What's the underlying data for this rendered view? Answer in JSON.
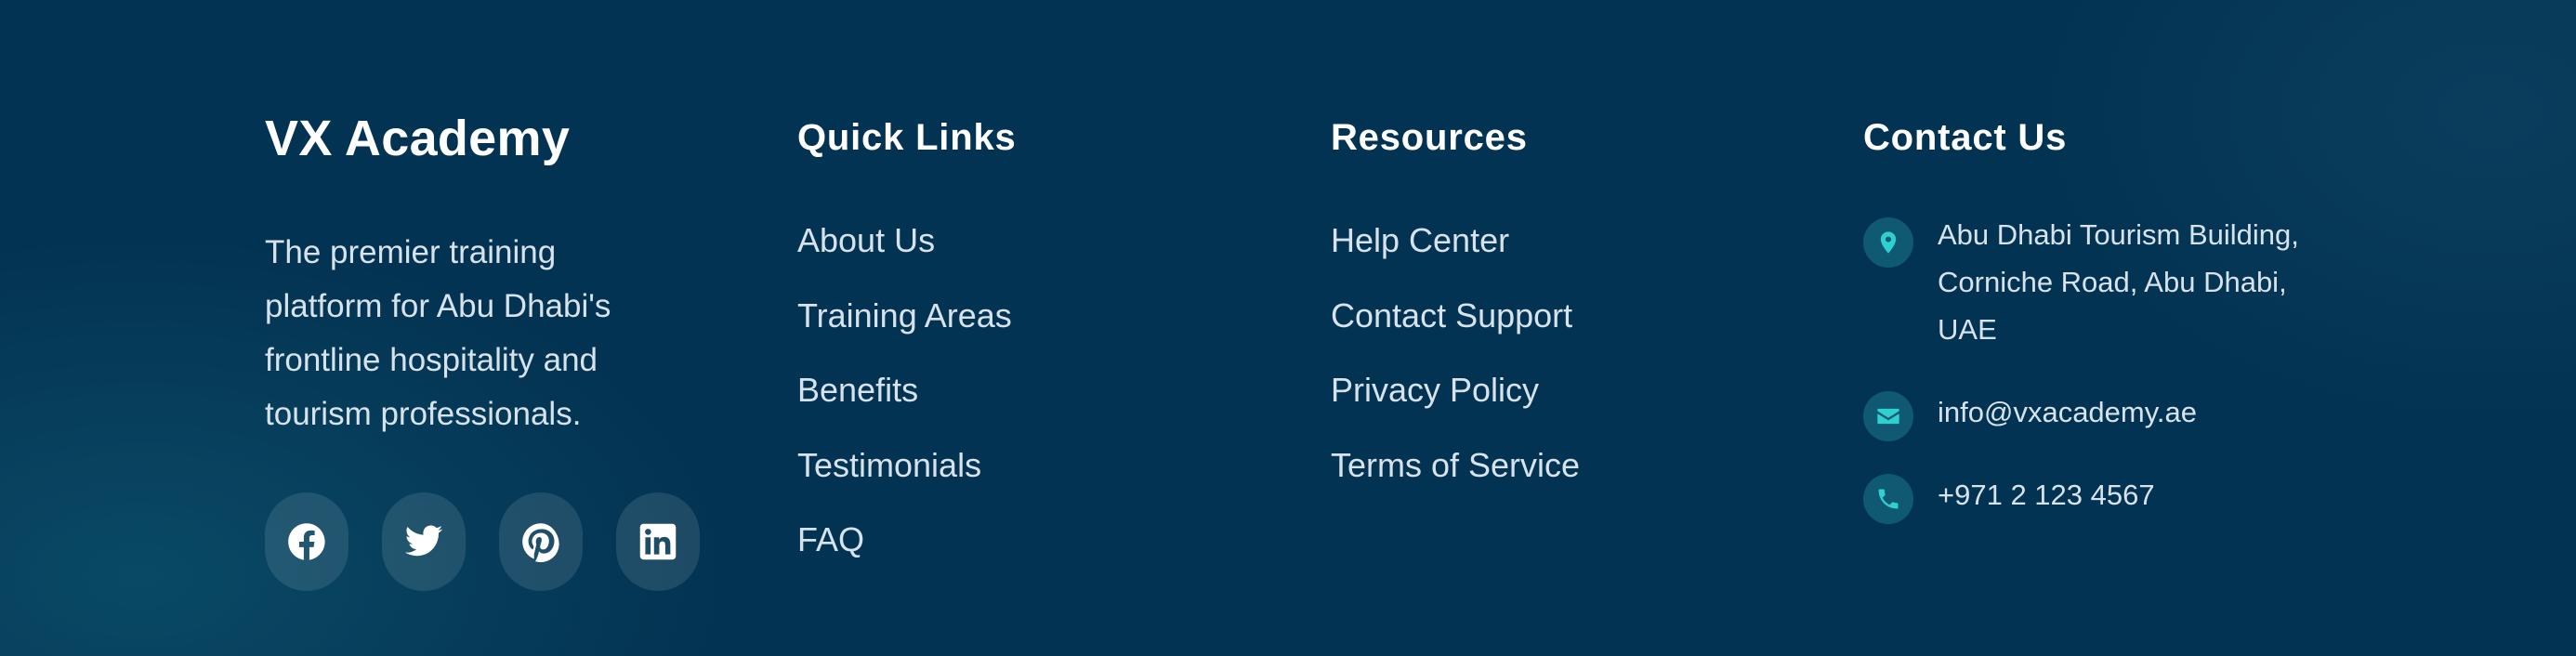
{
  "brand": {
    "title": "VX Academy",
    "description": "The premier training platform for Abu Dhabi's frontline hospitality and tourism professionals."
  },
  "social": [
    {
      "icon": "facebook-icon"
    },
    {
      "icon": "twitter-icon"
    },
    {
      "icon": "pinterest-icon"
    },
    {
      "icon": "linkedin-icon"
    }
  ],
  "quick_links": {
    "heading": "Quick Links",
    "items": [
      "About Us",
      "Training Areas",
      "Benefits",
      "Testimonials",
      "FAQ"
    ]
  },
  "resources": {
    "heading": "Resources",
    "items": [
      "Help Center",
      "Contact Support",
      "Privacy Policy",
      "Terms of Service"
    ]
  },
  "contact": {
    "heading": "Contact Us",
    "address": "Abu Dhabi Tourism Building, Corniche Road, Abu Dhabi, UAE",
    "email": "info@vxacademy.ae",
    "phone": "+971 2 123 4567"
  },
  "colors": {
    "background": "#033352",
    "accent": "#2fd0cf",
    "text": "#d7e2ea",
    "heading": "#ffffff"
  }
}
